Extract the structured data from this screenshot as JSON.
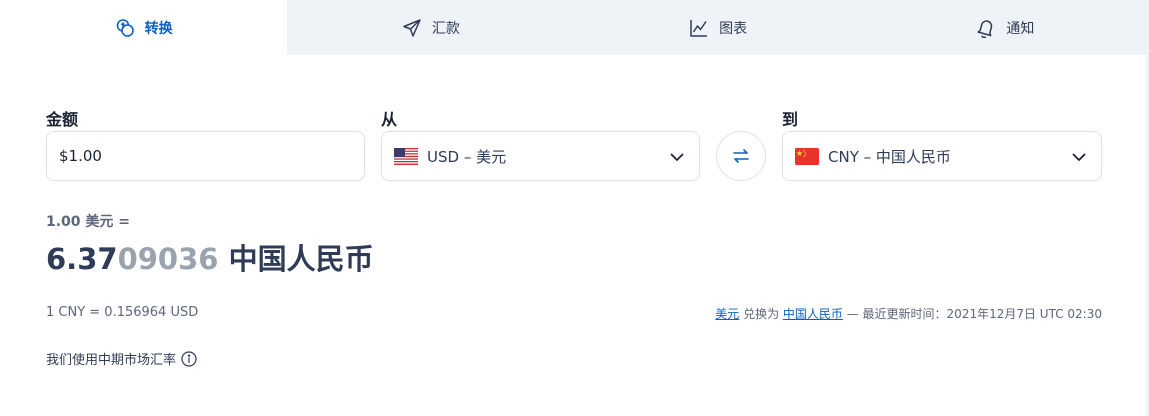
{
  "tabs": [
    {
      "label": "转换",
      "icon": "coins-icon",
      "active": true
    },
    {
      "label": "汇款",
      "icon": "send-icon",
      "active": false
    },
    {
      "label": "图表",
      "icon": "chart-icon",
      "active": false
    },
    {
      "label": "通知",
      "icon": "bell-icon",
      "active": false
    }
  ],
  "amount": {
    "label": "金额",
    "value": "$1.00"
  },
  "from": {
    "label": "从",
    "currency": "USD – 美元",
    "flag": "us-flag-icon"
  },
  "to": {
    "label": "到",
    "currency": "CNY – 中国人民币",
    "flag": "cn-flag-icon"
  },
  "swap_icon": "swap-arrows-icon",
  "result": {
    "from_amount": "1.00 美元 =",
    "value_main": "6.37",
    "value_dim": "09036",
    "currency_name": " 中国人民币"
  },
  "inverse_rate": "1 CNY = 0.156964 USD",
  "update": {
    "from_link": "美元",
    "middle": " 兑换为 ",
    "to_link": "中国人民币",
    "suffix": " — 最近更新时间：2021年12月7日 UTC 02:30"
  },
  "midmarket_note": "我们使用中期市场汇率",
  "colors": {
    "accent": "#0e61c1",
    "text": "#2e3c57",
    "tab_bg": "#eff3f8"
  }
}
